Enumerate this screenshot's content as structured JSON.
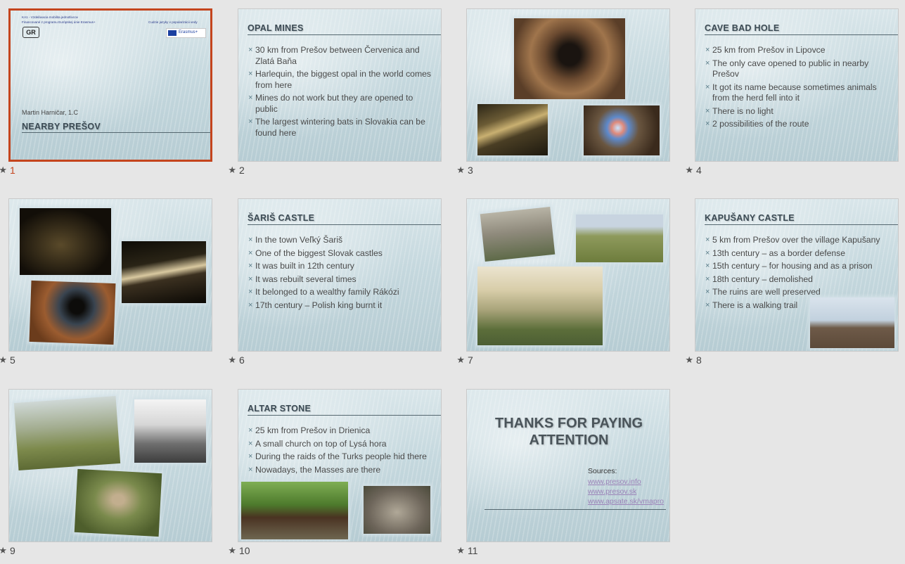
{
  "accent_color": "#c4441d",
  "star_glyph": "★",
  "slides": [
    {
      "number": "1",
      "selected": true,
      "header_line1": "KA1 - Vzdelávacia mobilita jednotlivcov",
      "header_line2": "Financované z programu Európskej únie Erasmus+",
      "header_right": "Cudzie jazyky v popularizácii vedy",
      "erasmus_label": "Erasmus+",
      "logo_text": "GR",
      "author": "Martin Harničar, 1.C",
      "title": "NEARBY PREŠOV"
    },
    {
      "number": "2",
      "title": "OPAL MINES",
      "bullets": [
        "30 km from Prešov between Červenica and Zlatá Baňa",
        "Harlequin, the biggest opal in the world comes from here",
        "Mines do not work but they are opened to public",
        "The largest wintering bats in Slovakia can be found here"
      ]
    },
    {
      "number": "3",
      "images": [
        "mine-tunnel-photo",
        "crystal-photo",
        "opal-photo"
      ]
    },
    {
      "number": "4",
      "title": "CAVE BAD HOLE",
      "bullets": [
        "25 km from Prešov in Lipovce",
        "The only cave opened to public in nearby Prešov",
        "It got its name because sometimes animals from the herd fell into it",
        "There is no light",
        "2 possibilities of the route"
      ]
    },
    {
      "number": "5",
      "images": [
        "cave-photo-1",
        "cave-photo-2",
        "cave-photo-3"
      ]
    },
    {
      "number": "6",
      "title": "ŠARIŠ CASTLE",
      "bullets": [
        "In the town Veľký Šariš",
        "One of the biggest Slovak castles",
        "It was built in 12th century",
        "It was rebuilt several times",
        "It belonged to a wealthy family Rákózi",
        "17th century – Polish king burnt it"
      ]
    },
    {
      "number": "7",
      "images": [
        "castle-ruins-photo",
        "castle-hill-photo",
        "castle-historical-map"
      ]
    },
    {
      "number": "8",
      "title": "KAPUŠANY CASTLE",
      "bullets": [
        "5 km from Prešov over the village Kapušany",
        "13th century – as a border defense",
        "15th century – for housing and as a prison",
        "18th century – demolished",
        "The ruins are well preserved",
        "There is a walking trail"
      ]
    },
    {
      "number": "9",
      "images": [
        "landscape-photo",
        "castle-sketch",
        "aerial-castle-photo"
      ]
    },
    {
      "number": "10",
      "title": "ALTAR STONE",
      "bullets": [
        "25 km from Prešov in Drienica",
        "A small church on top of Lysá hora",
        "During the raids of the Turks people hid there",
        "Nowadays, the Masses are there"
      ]
    },
    {
      "number": "11",
      "title": "THANKS FOR PAYING ATTENTION",
      "sources_label": "Sources:",
      "links": [
        "www.presov.info",
        "www.presov.sk",
        "www.apsate.sk/vmapro"
      ]
    }
  ]
}
